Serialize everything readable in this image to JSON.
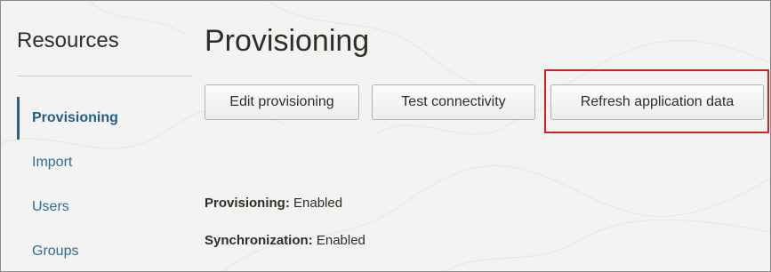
{
  "sidebar": {
    "title": "Resources",
    "items": [
      {
        "label": "Provisioning",
        "active": true
      },
      {
        "label": "Import",
        "active": false
      },
      {
        "label": "Users",
        "active": false
      },
      {
        "label": "Groups",
        "active": false
      }
    ]
  },
  "main": {
    "title": "Provisioning",
    "buttons": {
      "edit": "Edit provisioning",
      "test": "Test connectivity",
      "refresh": "Refresh application data"
    },
    "status": {
      "provisioning_label": "Provisioning:",
      "provisioning_value": "Enabled",
      "sync_label": "Synchronization:",
      "sync_value": "Enabled"
    }
  },
  "colors": {
    "highlight": "#d61f26",
    "link": "#2e6c95",
    "active_border": "#2e5f86",
    "background": "#f3f3f1"
  }
}
